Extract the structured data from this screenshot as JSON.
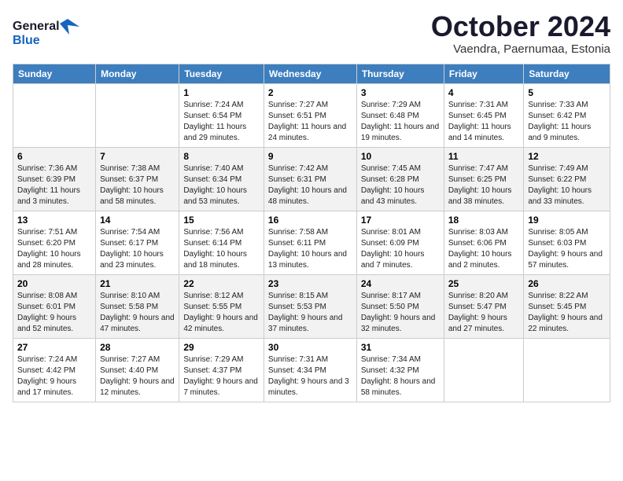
{
  "logo": {
    "line1": "General",
    "line2": "Blue"
  },
  "title": "October 2024",
  "subtitle": "Vaendra, Paernumaa, Estonia",
  "header": {
    "days": [
      "Sunday",
      "Monday",
      "Tuesday",
      "Wednesday",
      "Thursday",
      "Friday",
      "Saturday"
    ]
  },
  "weeks": [
    [
      {
        "day": "",
        "sunrise": "",
        "sunset": "",
        "daylight": ""
      },
      {
        "day": "",
        "sunrise": "",
        "sunset": "",
        "daylight": ""
      },
      {
        "day": "1",
        "sunrise": "Sunrise: 7:24 AM",
        "sunset": "Sunset: 6:54 PM",
        "daylight": "Daylight: 11 hours and 29 minutes."
      },
      {
        "day": "2",
        "sunrise": "Sunrise: 7:27 AM",
        "sunset": "Sunset: 6:51 PM",
        "daylight": "Daylight: 11 hours and 24 minutes."
      },
      {
        "day": "3",
        "sunrise": "Sunrise: 7:29 AM",
        "sunset": "Sunset: 6:48 PM",
        "daylight": "Daylight: 11 hours and 19 minutes."
      },
      {
        "day": "4",
        "sunrise": "Sunrise: 7:31 AM",
        "sunset": "Sunset: 6:45 PM",
        "daylight": "Daylight: 11 hours and 14 minutes."
      },
      {
        "day": "5",
        "sunrise": "Sunrise: 7:33 AM",
        "sunset": "Sunset: 6:42 PM",
        "daylight": "Daylight: 11 hours and 9 minutes."
      }
    ],
    [
      {
        "day": "6",
        "sunrise": "Sunrise: 7:36 AM",
        "sunset": "Sunset: 6:39 PM",
        "daylight": "Daylight: 11 hours and 3 minutes."
      },
      {
        "day": "7",
        "sunrise": "Sunrise: 7:38 AM",
        "sunset": "Sunset: 6:37 PM",
        "daylight": "Daylight: 10 hours and 58 minutes."
      },
      {
        "day": "8",
        "sunrise": "Sunrise: 7:40 AM",
        "sunset": "Sunset: 6:34 PM",
        "daylight": "Daylight: 10 hours and 53 minutes."
      },
      {
        "day": "9",
        "sunrise": "Sunrise: 7:42 AM",
        "sunset": "Sunset: 6:31 PM",
        "daylight": "Daylight: 10 hours and 48 minutes."
      },
      {
        "day": "10",
        "sunrise": "Sunrise: 7:45 AM",
        "sunset": "Sunset: 6:28 PM",
        "daylight": "Daylight: 10 hours and 43 minutes."
      },
      {
        "day": "11",
        "sunrise": "Sunrise: 7:47 AM",
        "sunset": "Sunset: 6:25 PM",
        "daylight": "Daylight: 10 hours and 38 minutes."
      },
      {
        "day": "12",
        "sunrise": "Sunrise: 7:49 AM",
        "sunset": "Sunset: 6:22 PM",
        "daylight": "Daylight: 10 hours and 33 minutes."
      }
    ],
    [
      {
        "day": "13",
        "sunrise": "Sunrise: 7:51 AM",
        "sunset": "Sunset: 6:20 PM",
        "daylight": "Daylight: 10 hours and 28 minutes."
      },
      {
        "day": "14",
        "sunrise": "Sunrise: 7:54 AM",
        "sunset": "Sunset: 6:17 PM",
        "daylight": "Daylight: 10 hours and 23 minutes."
      },
      {
        "day": "15",
        "sunrise": "Sunrise: 7:56 AM",
        "sunset": "Sunset: 6:14 PM",
        "daylight": "Daylight: 10 hours and 18 minutes."
      },
      {
        "day": "16",
        "sunrise": "Sunrise: 7:58 AM",
        "sunset": "Sunset: 6:11 PM",
        "daylight": "Daylight: 10 hours and 13 minutes."
      },
      {
        "day": "17",
        "sunrise": "Sunrise: 8:01 AM",
        "sunset": "Sunset: 6:09 PM",
        "daylight": "Daylight: 10 hours and 7 minutes."
      },
      {
        "day": "18",
        "sunrise": "Sunrise: 8:03 AM",
        "sunset": "Sunset: 6:06 PM",
        "daylight": "Daylight: 10 hours and 2 minutes."
      },
      {
        "day": "19",
        "sunrise": "Sunrise: 8:05 AM",
        "sunset": "Sunset: 6:03 PM",
        "daylight": "Daylight: 9 hours and 57 minutes."
      }
    ],
    [
      {
        "day": "20",
        "sunrise": "Sunrise: 8:08 AM",
        "sunset": "Sunset: 6:01 PM",
        "daylight": "Daylight: 9 hours and 52 minutes."
      },
      {
        "day": "21",
        "sunrise": "Sunrise: 8:10 AM",
        "sunset": "Sunset: 5:58 PM",
        "daylight": "Daylight: 9 hours and 47 minutes."
      },
      {
        "day": "22",
        "sunrise": "Sunrise: 8:12 AM",
        "sunset": "Sunset: 5:55 PM",
        "daylight": "Daylight: 9 hours and 42 minutes."
      },
      {
        "day": "23",
        "sunrise": "Sunrise: 8:15 AM",
        "sunset": "Sunset: 5:53 PM",
        "daylight": "Daylight: 9 hours and 37 minutes."
      },
      {
        "day": "24",
        "sunrise": "Sunrise: 8:17 AM",
        "sunset": "Sunset: 5:50 PM",
        "daylight": "Daylight: 9 hours and 32 minutes."
      },
      {
        "day": "25",
        "sunrise": "Sunrise: 8:20 AM",
        "sunset": "Sunset: 5:47 PM",
        "daylight": "Daylight: 9 hours and 27 minutes."
      },
      {
        "day": "26",
        "sunrise": "Sunrise: 8:22 AM",
        "sunset": "Sunset: 5:45 PM",
        "daylight": "Daylight: 9 hours and 22 minutes."
      }
    ],
    [
      {
        "day": "27",
        "sunrise": "Sunrise: 7:24 AM",
        "sunset": "Sunset: 4:42 PM",
        "daylight": "Daylight: 9 hours and 17 minutes."
      },
      {
        "day": "28",
        "sunrise": "Sunrise: 7:27 AM",
        "sunset": "Sunset: 4:40 PM",
        "daylight": "Daylight: 9 hours and 12 minutes."
      },
      {
        "day": "29",
        "sunrise": "Sunrise: 7:29 AM",
        "sunset": "Sunset: 4:37 PM",
        "daylight": "Daylight: 9 hours and 7 minutes."
      },
      {
        "day": "30",
        "sunrise": "Sunrise: 7:31 AM",
        "sunset": "Sunset: 4:34 PM",
        "daylight": "Daylight: 9 hours and 3 minutes."
      },
      {
        "day": "31",
        "sunrise": "Sunrise: 7:34 AM",
        "sunset": "Sunset: 4:32 PM",
        "daylight": "Daylight: 8 hours and 58 minutes."
      },
      {
        "day": "",
        "sunrise": "",
        "sunset": "",
        "daylight": ""
      },
      {
        "day": "",
        "sunrise": "",
        "sunset": "",
        "daylight": ""
      }
    ]
  ]
}
